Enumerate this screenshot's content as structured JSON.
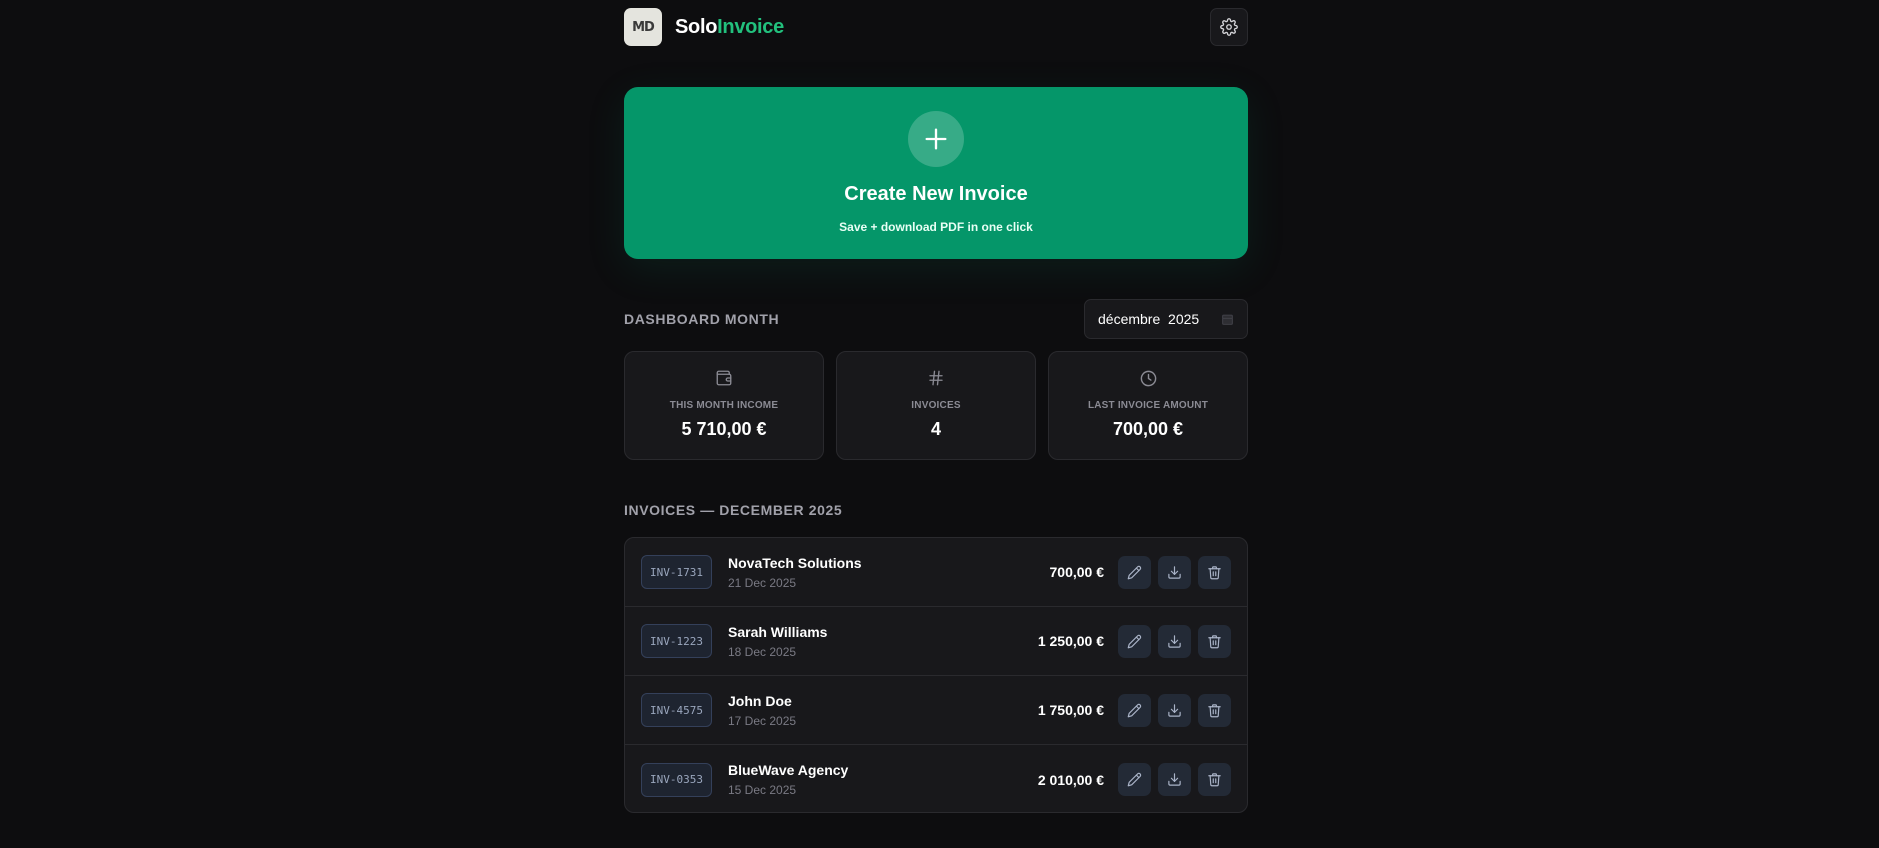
{
  "header": {
    "logo_text": "MD",
    "brand_part1": "Solo",
    "brand_part2": "Invoice",
    "settings_icon": "gear-icon"
  },
  "create": {
    "icon": "plus-icon",
    "title": "Create New Invoice",
    "subtitle": "Save + download PDF in one click"
  },
  "dashboard": {
    "label": "DASHBOARD MONTH",
    "month_value": "décembre  2025",
    "month_icon": "calendar-icon"
  },
  "stats": [
    {
      "icon": "wallet-icon",
      "label": "THIS MONTH INCOME",
      "value": "5 710,00 €"
    },
    {
      "icon": "hash-icon",
      "label": "INVOICES",
      "value": "4"
    },
    {
      "icon": "clock-icon",
      "label": "LAST INVOICE AMOUNT",
      "value": "700,00 €"
    }
  ],
  "invoices": {
    "title": "INVOICES — DECEMBER 2025",
    "rows": [
      {
        "number": "INV-1731",
        "client": "NovaTech Solutions",
        "date": "21 Dec 2025",
        "amount": "700,00 €"
      },
      {
        "number": "INV-1223",
        "client": "Sarah Williams",
        "date": "18 Dec 2025",
        "amount": "1 250,00 €"
      },
      {
        "number": "INV-4575",
        "client": "John Doe",
        "date": "17 Dec 2025",
        "amount": "1 750,00 €"
      },
      {
        "number": "INV-0353",
        "client": "BlueWave Agency",
        "date": "15 Dec 2025",
        "amount": "2 010,00 €"
      }
    ],
    "row_actions": [
      "pencil-icon",
      "download-icon",
      "trash-icon"
    ]
  },
  "colors": {
    "background": "#0d0d0f",
    "card": "#18181b",
    "accent": "#059669",
    "brand_accent": "#22c07d"
  }
}
